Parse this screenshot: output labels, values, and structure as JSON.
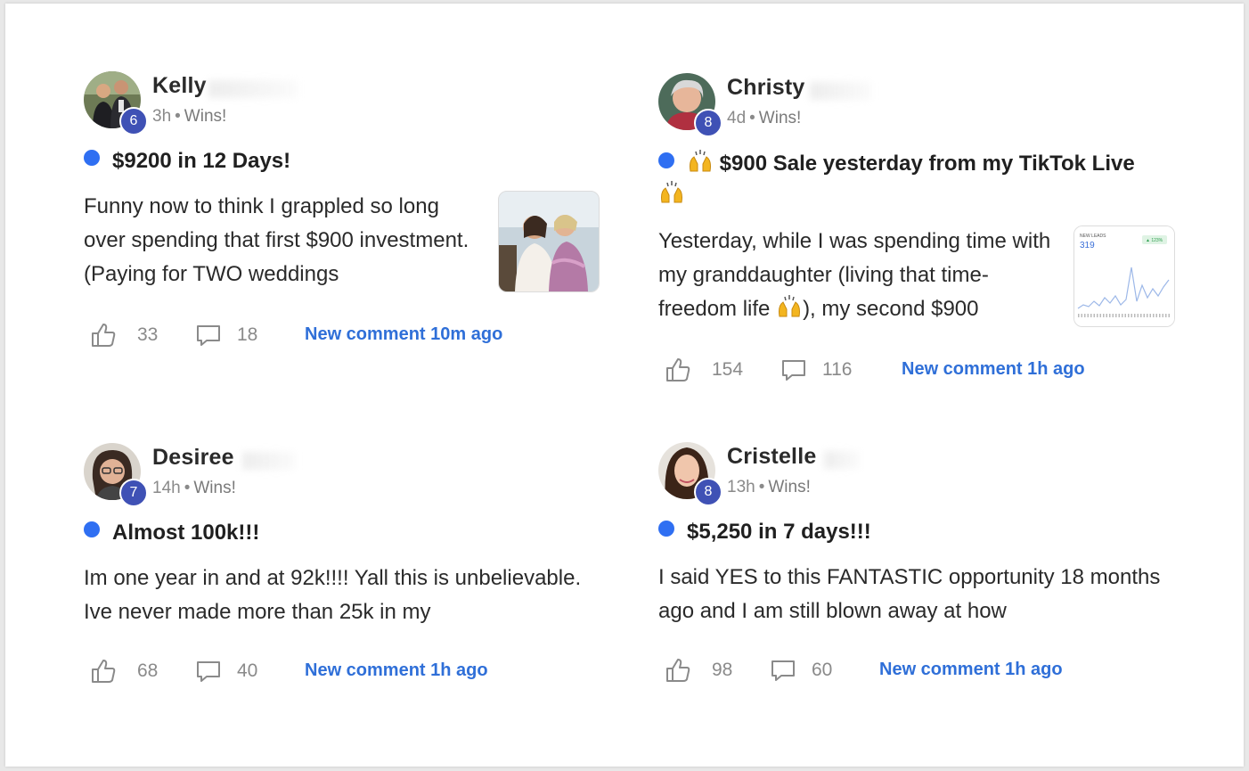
{
  "posts": [
    {
      "author": "Kelly",
      "level": "6",
      "time": "3h",
      "category": "Wins!",
      "title": "$9200 in 12 Days!",
      "body": "Funny now to think I grappled so long over spending that first $900 investment. (Paying for TWO weddings",
      "likes": "33",
      "comments": "18",
      "new_comment": "New comment 10m ago",
      "thumbnail": "photo-two-women-wedding"
    },
    {
      "author": "Christy",
      "level": "8",
      "time": "4d",
      "category": "Wins!",
      "title": "$900 Sale yesterday from my TikTok Live",
      "title_emoji": "raising-hands-emoji",
      "body": "Yesterday, while I was spending time with my granddaughter (living that time-freedom life",
      "body_after_emoji": "), my second $900",
      "likes": "154",
      "comments": "116",
      "new_comment": "New comment 1h ago",
      "thumbnail": "new-leads-chart",
      "thumb_label": "NEW LEADS",
      "thumb_value": "319",
      "thumb_badge": "▲ 123%"
    },
    {
      "author": "Desiree",
      "level": "7",
      "time": "14h",
      "category": "Wins!",
      "title": "Almost 100k!!!",
      "body": "Im one year in and at 92k!!!! Yall this is unbelievable. Ive never made more than 25k in my",
      "likes": "68",
      "comments": "40",
      "new_comment": "New comment 1h ago"
    },
    {
      "author": "Cristelle",
      "level": "8",
      "time": "13h",
      "category": "Wins!",
      "title": "$5,250 in 7 days!!!",
      "body": "I said YES to this FANTASTIC opportunity 18 months ago and I am still blown away at how",
      "likes": "98",
      "comments": "60",
      "new_comment": "New comment 1h ago"
    }
  ],
  "separator": "•",
  "colors": {
    "unread_dot": "#2f6ff2",
    "level_badge": "#3f51b5",
    "new_comment_link": "#2f6fd8",
    "muted_text": "#8a8a8a"
  }
}
